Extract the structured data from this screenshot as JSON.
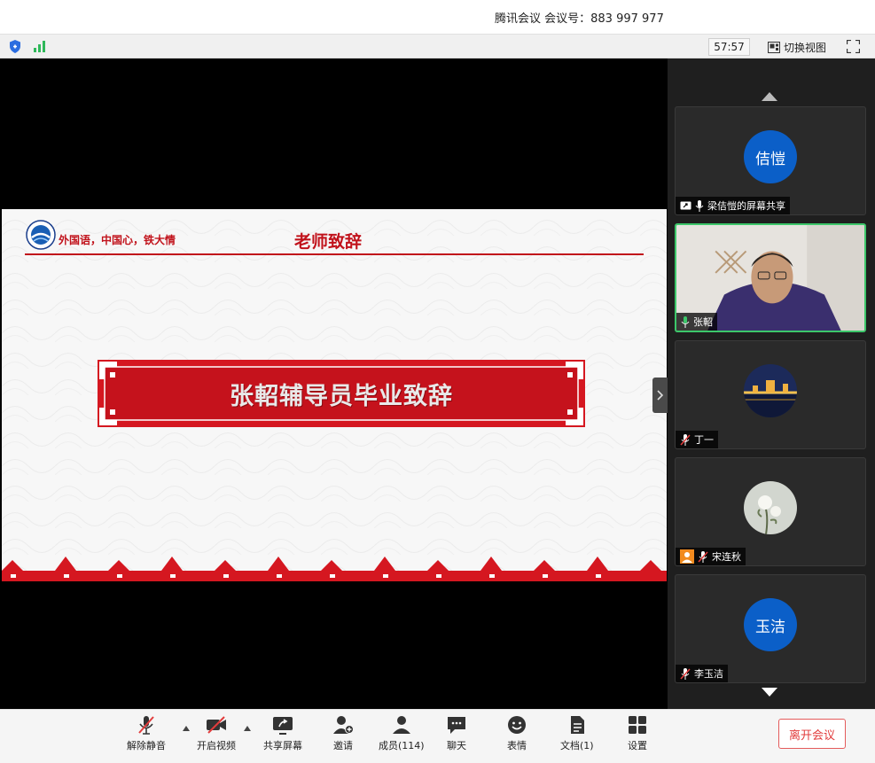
{
  "window": {
    "title": "腾讯会议 会议号：883 997 977"
  },
  "statusbar": {
    "timer": "57:57",
    "switch_view_label": "切换视图"
  },
  "slide": {
    "motto": "外国语，中国心，铁大情",
    "title": "老师致辞",
    "banner_text": "张軺辅导员毕业致辞"
  },
  "participants": [
    {
      "avatar_text": "佶愷",
      "name": "梁佶愷的屏幕共享",
      "avatar_color": "#0b5fc8"
    },
    {
      "name": "张軺",
      "speaking": true
    },
    {
      "name": "丁一"
    },
    {
      "name": "宋连秋"
    },
    {
      "avatar_text": "玉洁",
      "name": "李玉洁",
      "avatar_color": "#0b5fc8"
    }
  ],
  "toolbar": {
    "mute_label": "解除静音",
    "video_label": "开启视频",
    "share_label": "共享屏幕",
    "invite_label": "邀请",
    "members_label": "成员(114)",
    "chat_label": "聊天",
    "emoji_label": "表情",
    "docs_label": "文档(1)",
    "settings_label": "设置",
    "leave_label": "离开会议"
  },
  "colors": {
    "accent_green": "#3cc76a",
    "slide_red": "#c1121b",
    "avatar_blue": "#0b5fc8",
    "leave_red": "#e23c3c"
  }
}
